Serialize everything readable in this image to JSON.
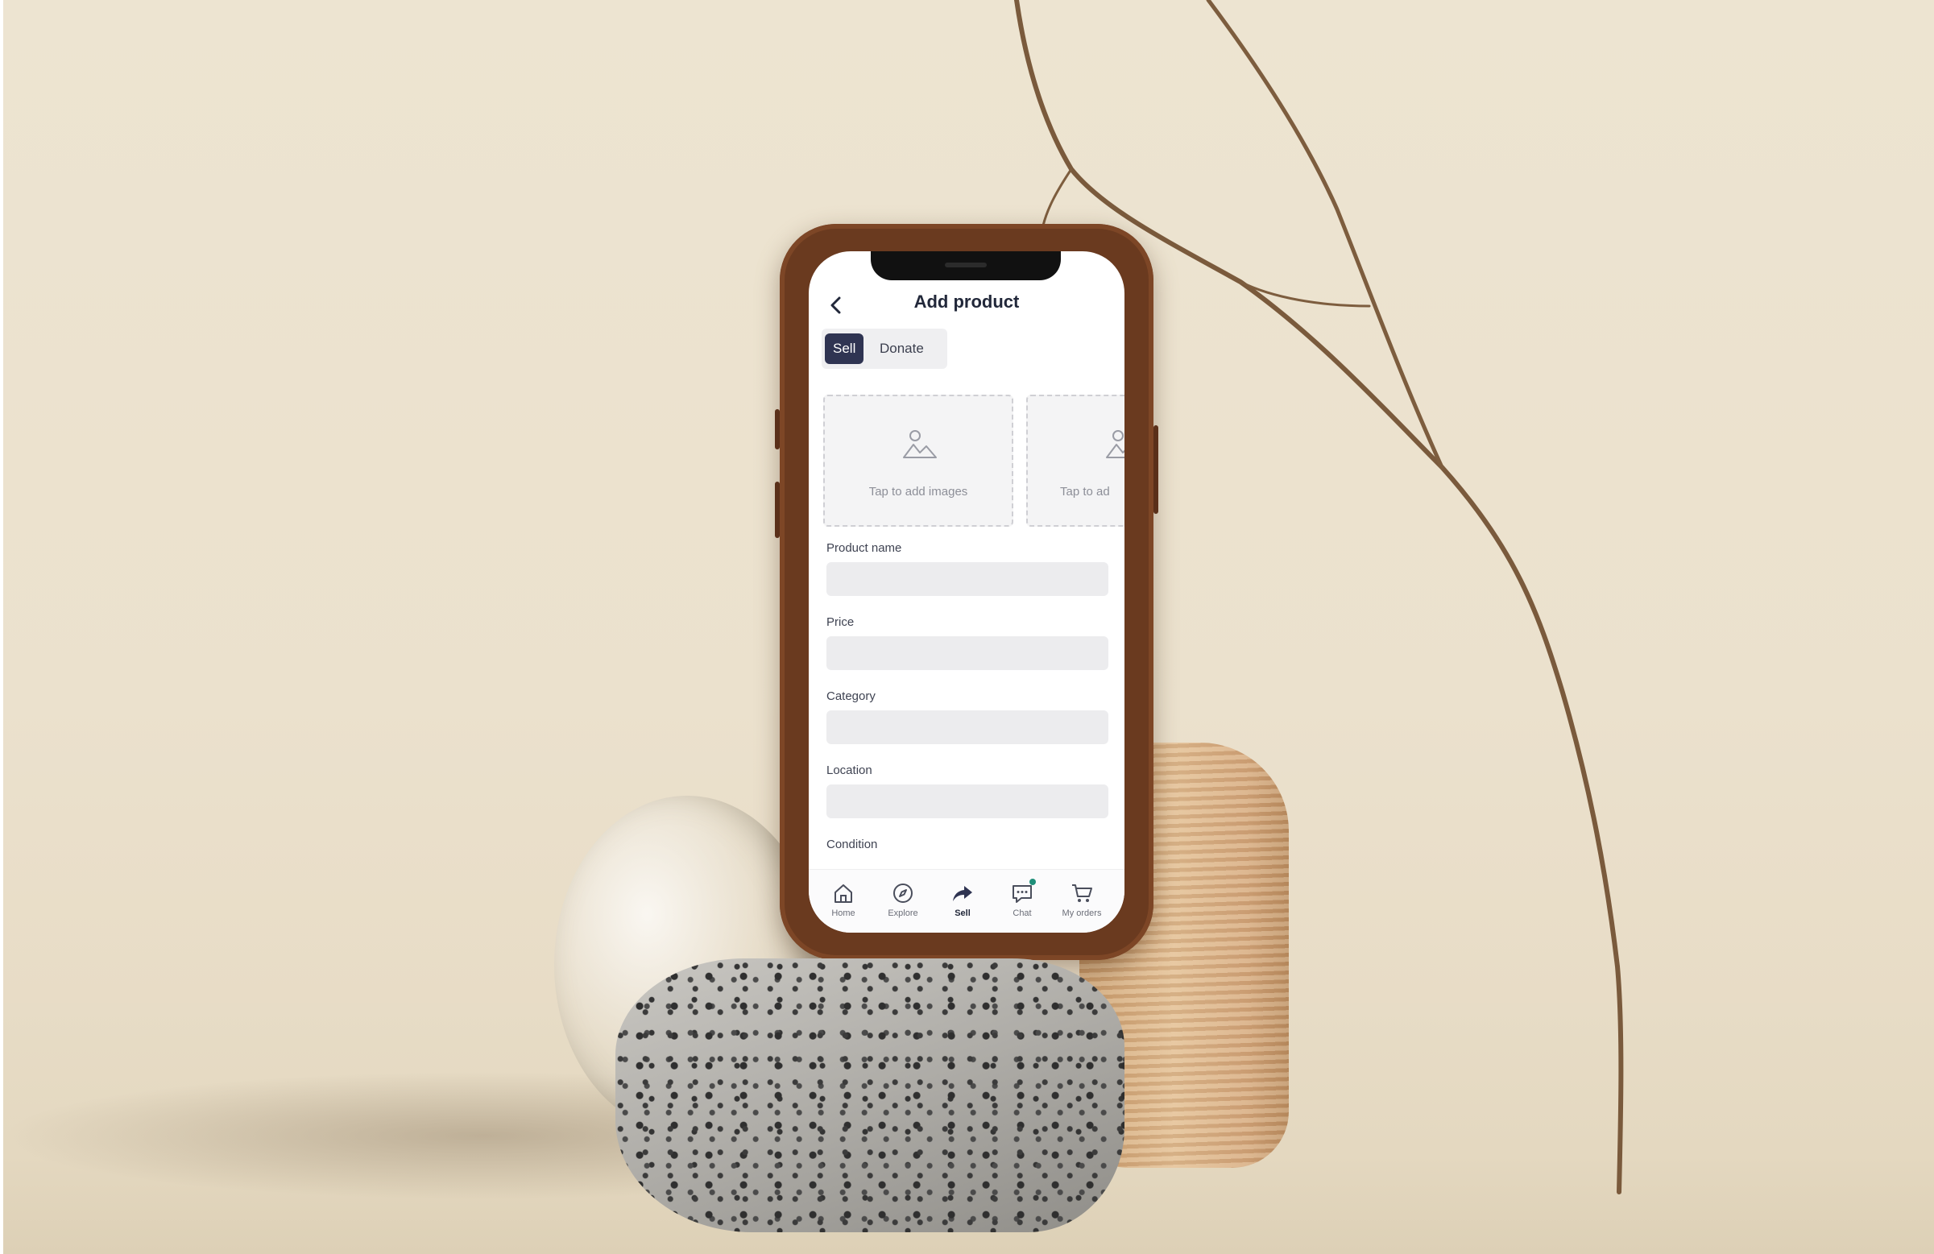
{
  "screen": {
    "title": "Add product",
    "back_icon": "chevron-left-icon"
  },
  "mode_toggle": {
    "options": [
      "Sell",
      "Donate"
    ],
    "selected": "Sell"
  },
  "image_upload": {
    "tiles": [
      {
        "caption": "Tap to add images",
        "icon": "image-placeholder-icon"
      },
      {
        "caption": "Tap to ad",
        "icon": "image-placeholder-icon"
      }
    ]
  },
  "form": {
    "fields": [
      {
        "label": "Product name",
        "value": ""
      },
      {
        "label": "Price",
        "value": ""
      },
      {
        "label": "Category",
        "value": ""
      },
      {
        "label": "Location",
        "value": ""
      },
      {
        "label": "Condition",
        "value": ""
      }
    ]
  },
  "tabbar": {
    "items": [
      {
        "label": "Home",
        "icon": "home-icon"
      },
      {
        "label": "Explore",
        "icon": "compass-icon"
      },
      {
        "label": "Sell",
        "icon": "share-arrow-icon",
        "active": true
      },
      {
        "label": "Chat",
        "icon": "chat-icon",
        "badge": "unread-dot"
      },
      {
        "label": "My orders",
        "icon": "cart-icon"
      }
    ]
  },
  "colors": {
    "primary": "#2f3452",
    "title_text": "#22283a",
    "badge": "#1f8f7a",
    "phone_case": "#6a3a1f",
    "background": "#ebe2cf"
  }
}
